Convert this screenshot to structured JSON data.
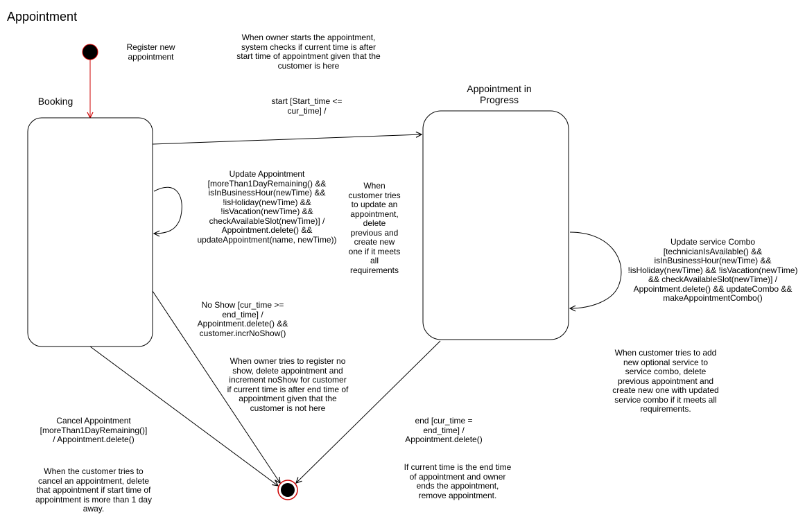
{
  "title": "Appointment",
  "colors": {
    "line": "#000000",
    "initial_arrow": "#cc0000",
    "final_ring": "#cc0000",
    "node_fill": "#000000"
  },
  "states": {
    "booking": {
      "label": "Booking"
    },
    "in_progress": {
      "label": "Appointment in\nProgress"
    }
  },
  "nodes": {
    "initial": {
      "label": "Register new\nappointment"
    }
  },
  "transitions": {
    "start": {
      "label": "start [Start_time <=\ncur_time] /",
      "note": "When owner starts the appointment,\nsystem checks if current time is after\nstart time of appointment given that the\ncustomer is here"
    },
    "update_appointment": {
      "label": "Update Appointment\n[moreThan1DayRemaining() &&\nisInBusinessHour(newTime) &&\n!isHoliday(newTime) &&\n!isVacation(newTime) &&\ncheckAvailableSlot(newTime)] /\nAppointment.delete() &&\nupdateAppointment(name, newTime))",
      "note": "When\ncustomer tries\nto update an\nappointment,\ndelete\nprevious and\ncreate new\none if it meets\nall\nrequirements"
    },
    "update_combo": {
      "label": "Update service Combo\n[technicianIsAvailable() &&\nisInBusinessHour(newTime) &&\n!isHoliday(newTime) && !isVacation(newTime)\n&& checkAvailableSlot(newTime)] /\nAppointment.delete() && updateCombo &&\nmakeAppointmentCombo()",
      "note": "When customer tries to add\nnew optional service to\nservice combo, delete\nprevious appointment and\ncreate new one with updated\nservice combo if it meets all\nrequirements."
    },
    "no_show": {
      "label": "No Show [cur_time >=\nend_time] /\nAppointment.delete() &&\ncustomer.incrNoShow()",
      "note": "When owner tries to register no\nshow, delete appointment and\nincrement noShow for customer\nif current time is after end time of\nappointment given that the\ncustomer is not here"
    },
    "cancel": {
      "label": "Cancel Appointment\n[moreThan1DayRemaining()]\n/ Appointment.delete()",
      "note": "When the customer tries to\ncancel an appointment, delete\nthat appointment if start time of\nappointment is more than 1 day\naway."
    },
    "end": {
      "label": "end [cur_time =\nend_time] /\nAppointment.delete()",
      "note": "If current time is the end time\nof appointment and owner\nends the appointment,\nremove appointment."
    }
  }
}
